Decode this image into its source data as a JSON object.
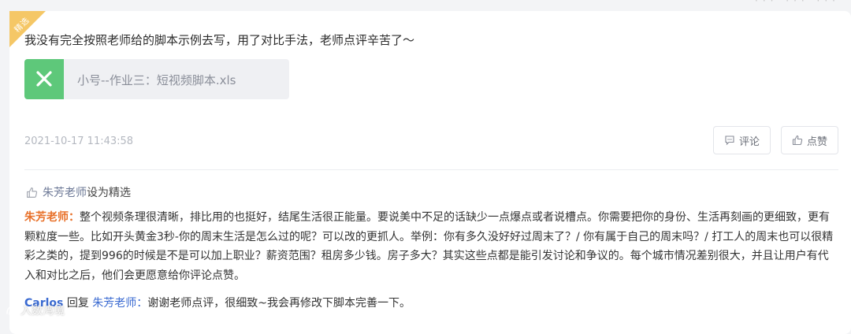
{
  "header": {
    "ghost_actions": "··· ··· ···"
  },
  "badge": {
    "label": "精选",
    "color": "#f5c766"
  },
  "post": {
    "text": "我没有完全按照老师给的脚本示例去写，用了对比手法，老师点评辛苦了～",
    "attachment": {
      "icon": "excel-icon",
      "name": "小号--作业三：短视频脚本.xls"
    },
    "timestamp": "2021-10-17 11:43:58",
    "comment_label": "评论",
    "like_label": "点赞"
  },
  "featured": {
    "teacher": "朱芳老师",
    "action": "设为精选"
  },
  "review": {
    "author": "朱芳老师：",
    "text": "整个视频条理很清晰，排比用的也挺好，结尾生活很正能量。要说美中不足的话缺少一点爆点或者说槽点。你需要把你的身份、生活再刻画的更细致，更有颗粒度一些。比如开头黄金3秒-你的周末生活是怎么过的呢？可以改的更抓人。举例：你有多久没好好过周末了？/ 你有属于自己的周末吗？/ 打工人的周末也可以很精彩之类的，提到996的时候是不是可以加上职业？薪资范围？租房多少钱。房子多大？其实这些点都是能引发讨论和争议的。每个城市情况差别很大，并且让用户有代入和对比之后，他们会更愿意给你评论点赞。"
  },
  "reply": {
    "replier": "Carlos",
    "verb": " 回复 ",
    "target": "朱芳老师：",
    "text": "谢谢老师点评，很细致~我会再修改下脚本完善一下。"
  },
  "watermark": {
    "text": "入数湾境"
  }
}
